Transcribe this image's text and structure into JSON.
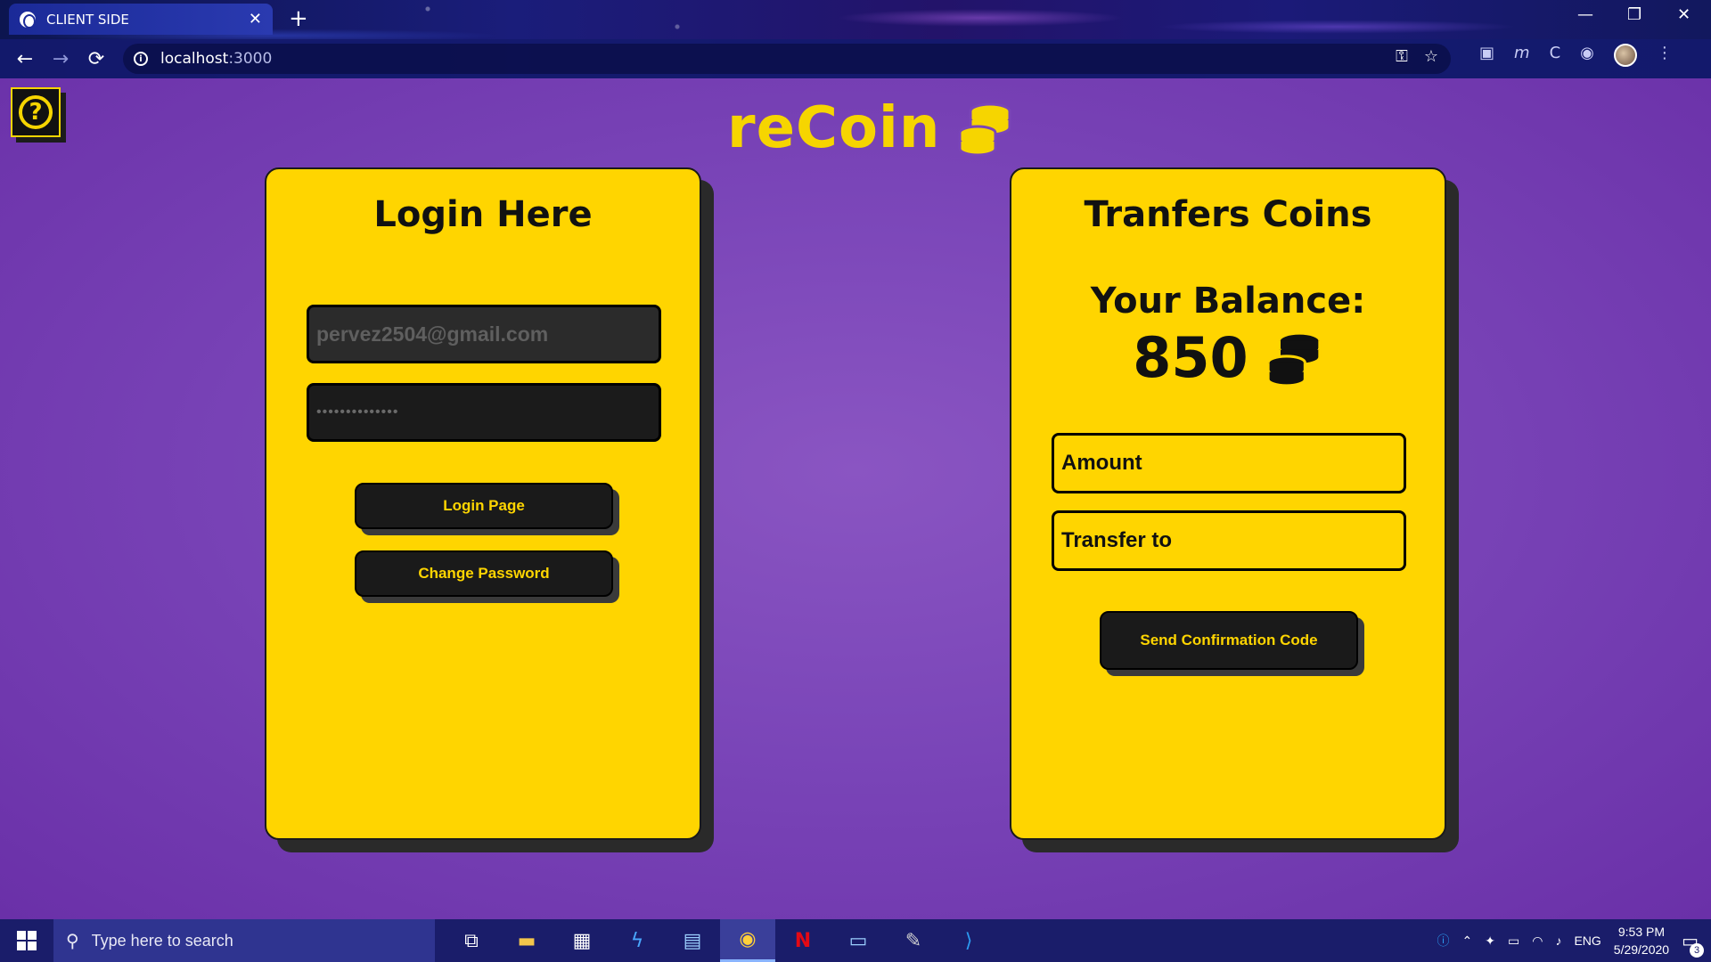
{
  "browser": {
    "tab_title": "CLIENT SIDE",
    "tab_close": "✕",
    "new_tab": "+",
    "url_host": "localhost",
    "url_port": ":3000",
    "window_controls": {
      "minimize": "—",
      "restore": "❐",
      "close": "✕"
    },
    "nav": {
      "back": "←",
      "forward": "→",
      "reload": "⟳"
    }
  },
  "page": {
    "help_symbol": "?",
    "logo_text": "reCoin",
    "login": {
      "title": "Login Here",
      "email_value": "pervez2504@gmail.com",
      "password_masked": "••••••••••••••",
      "login_button": "Login Page",
      "change_password_button": "Change Password"
    },
    "transfer": {
      "title": "Tranfers Coins",
      "balance_label": "Your Balance:",
      "balance_value": "850",
      "amount_placeholder": "Amount",
      "transfer_to_placeholder": "Transfer to",
      "send_button": "Send Confirmation Code"
    }
  },
  "taskbar": {
    "search_placeholder": "Type here to search",
    "language": "ENG",
    "time": "9:53 PM",
    "date": "5/29/2020",
    "notification_count": "3"
  },
  "colors": {
    "accent_yellow": "#ffd500",
    "background_purple": "#7a45b8",
    "dark": "#1a1a1a"
  }
}
